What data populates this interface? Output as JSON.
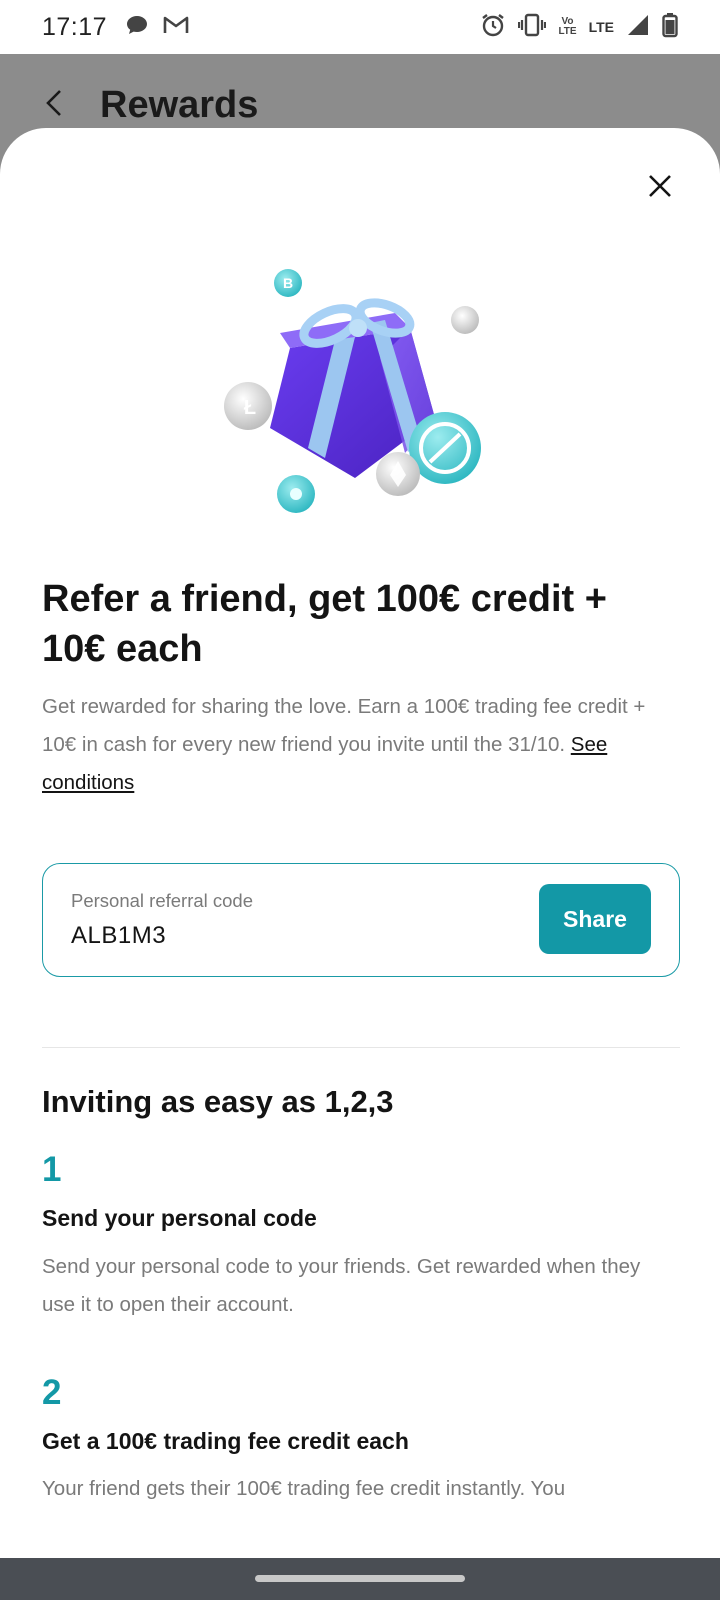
{
  "status_bar": {
    "time": "17:17",
    "left_icons": [
      "chat-bubble-icon",
      "gmail-icon"
    ],
    "right_icons": [
      "alarm-icon",
      "vibrate-icon",
      "volte-icon",
      "lte-icon",
      "signal-icon",
      "battery-icon"
    ],
    "volte_top": "Vo",
    "volte_bottom": "LTE",
    "lte": "LTE"
  },
  "background_page": {
    "title": "Rewards"
  },
  "sheet": {
    "headline": "Refer a friend, get 100€ credit + 10€ each",
    "description": "Get rewarded for sharing the love. Earn a 100€ trading fee credit + 10€ in cash for every new friend you invite until the 31/10. ",
    "conditions_link": "See conditions",
    "referral": {
      "label": "Personal referral code",
      "code": "ALB1M3",
      "share_label": "Share"
    },
    "steps_title": "Inviting as easy as 1,2,3",
    "steps": [
      {
        "number": "1",
        "title": "Send your personal code",
        "description": "Send your personal code to your friends. Get rewarded when they use it to open their account."
      },
      {
        "number": "2",
        "title": "Get a 100€ trading fee credit each",
        "description": "Your friend gets their 100€ trading fee credit instantly. You"
      }
    ]
  },
  "colors": {
    "accent": "#1398a6",
    "text_primary": "#141414",
    "text_secondary": "#7a7a7a",
    "gift_box": "#5b2fd6",
    "ribbon": "#9cc6f0"
  }
}
